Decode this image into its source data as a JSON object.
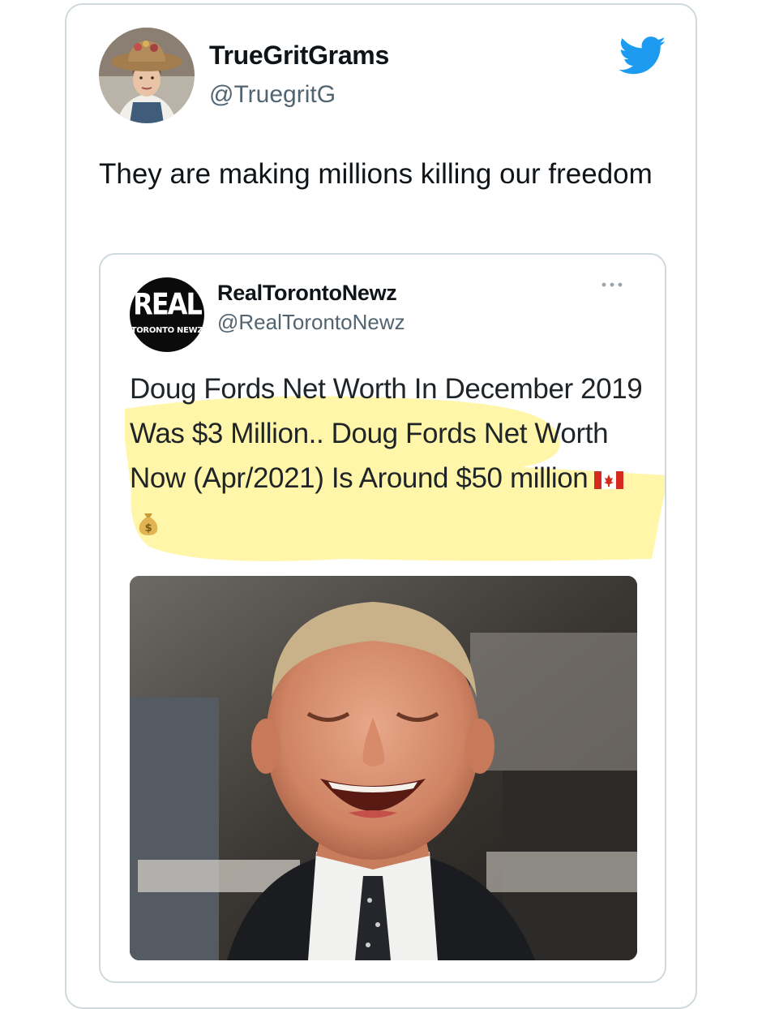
{
  "tweet": {
    "display_name": "TrueGritGrams",
    "handle": "@TruegritG",
    "text": "They are making millions killing our freedom",
    "avatar_icon": "user-avatar",
    "brand_icon": "twitter-bird-icon",
    "brand_color": "#1d9bf0"
  },
  "quoted_tweet": {
    "logo_text_main": "REAL",
    "logo_text_sub": "TORONTO NEWZ",
    "display_name": "RealTorontoNewz",
    "handle": "@RealTorontoNewz",
    "text": "Doug Fords Net Worth In December 2019 Was $3 Million.. Doug Fords Net Worth Now (Apr/2021) Is Around $50 million",
    "emojis": [
      "canada-flag-icon",
      "money-bag-icon"
    ],
    "highlight_color": "#fff59a",
    "more_icon": "more-options-icon",
    "photo": "laughing-man-photo"
  }
}
